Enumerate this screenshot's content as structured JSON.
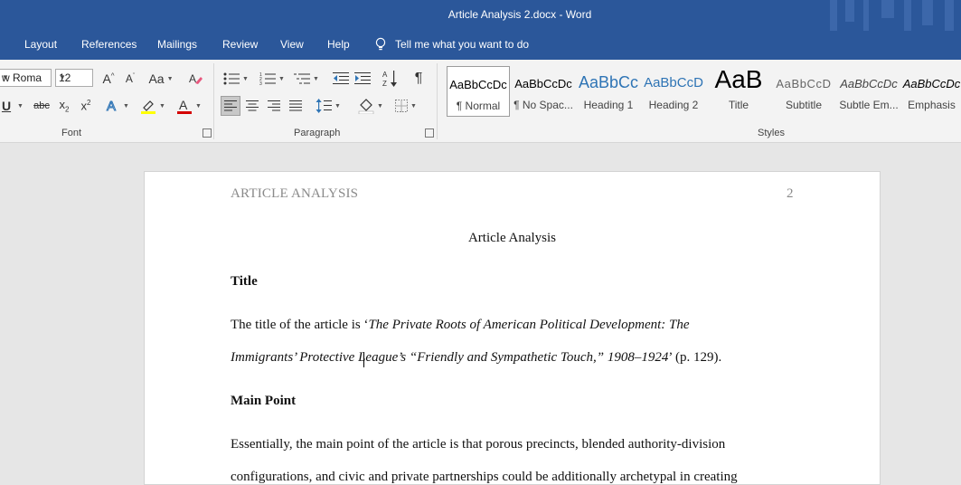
{
  "window": {
    "title": "Article Analysis 2.docx  -  Word"
  },
  "menu": {
    "items": [
      "Layout",
      "References",
      "Mailings",
      "Review",
      "View",
      "Help"
    ],
    "tell_me": "Tell me what you want to do"
  },
  "ribbon": {
    "font": {
      "name": "w Roma",
      "size": "12",
      "label": "Font"
    },
    "paragraph": {
      "label": "Paragraph"
    },
    "styles": {
      "label": "Styles",
      "items": [
        {
          "preview": "AaBbCcDc",
          "name": "¶ Normal"
        },
        {
          "preview": "AaBbCcDc",
          "name": "¶ No Spac..."
        },
        {
          "preview": "AaBbCc",
          "name": "Heading 1"
        },
        {
          "preview": "AaBbCcD",
          "name": "Heading 2"
        },
        {
          "preview": "AaB",
          "name": "Title"
        },
        {
          "preview": "AaBbCcD",
          "name": "Subtitle"
        },
        {
          "preview": "AaBbCcDc",
          "name": "Subtle Em..."
        },
        {
          "preview": "AaBbCcDc",
          "name": "Emphasis"
        }
      ]
    }
  },
  "document": {
    "header_left": "ARTICLE ANALYSIS",
    "page_number": "2",
    "heading": "Article Analysis",
    "section1_title": "Title",
    "p1_line1_start": "The title of the article is ‘",
    "p1_line1_italic": "The Private Roots of American Political Development: The",
    "p1_line2_italic": "Immigrants’ Protective League’s “Friendly and Sympathetic Touch,” 1908–1924",
    "p1_line2_end": "’ (p. 129).",
    "section2_title": "Main Point",
    "p2_line1": "Essentially, the main point of the article is that porous precincts, blended authority-division",
    "p2_line2": "configurations, and civic and private partnerships could be additionally archetypal in creating"
  },
  "colors": {
    "titlebar": "#2b579a",
    "ribbon": "#f3f3f3",
    "canvas": "#e6e6e6",
    "heading1": "#2e74b5"
  }
}
